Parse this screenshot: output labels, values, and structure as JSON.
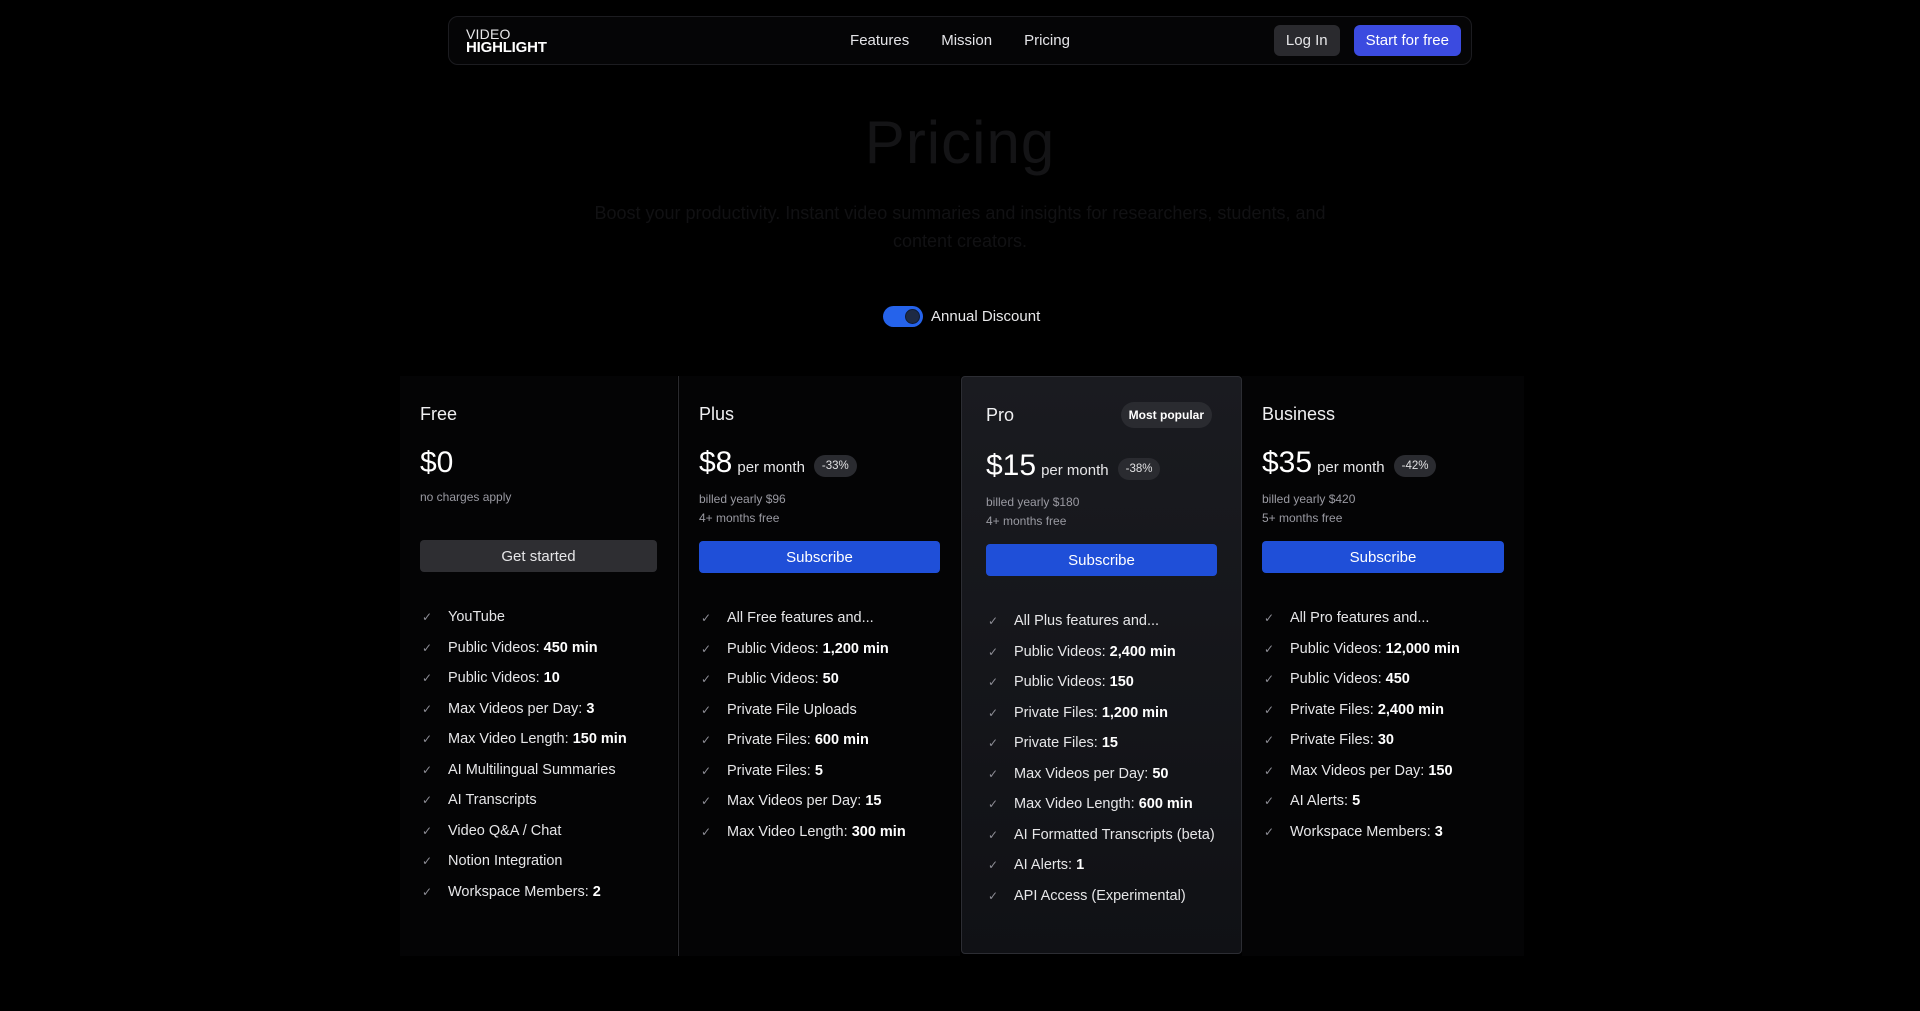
{
  "nav": {
    "logo_top": "VIDEO",
    "logo_bottom": "HIGHLIGHT",
    "links": [
      "Features",
      "Mission",
      "Pricing"
    ],
    "login": "Log In",
    "start": "Start for free"
  },
  "hero": {
    "title": "Pricing",
    "subtitle": "Boost your productivity. Instant video summaries and insights for researchers, students, and content creators."
  },
  "toggle": {
    "label": "Annual Discount",
    "on": true
  },
  "plans": [
    {
      "name": "Free",
      "price": "$0",
      "per": "",
      "discount": "",
      "note1": "no charges apply",
      "note2": "",
      "cta": "Get started",
      "features": [
        {
          "label": "YouTube",
          "value": ""
        },
        {
          "label": "Public Videos: ",
          "value": "450 min"
        },
        {
          "label": "Public Videos: ",
          "value": "10"
        },
        {
          "label": "Max Videos per Day: ",
          "value": "3"
        },
        {
          "label": "Max Video Length: ",
          "value": "150 min"
        },
        {
          "label": "AI Multilingual Summaries",
          "value": ""
        },
        {
          "label": "AI Transcripts",
          "value": ""
        },
        {
          "label": "Video Q&A / Chat",
          "value": ""
        },
        {
          "label": "Notion Integration",
          "value": ""
        },
        {
          "label": "Workspace Members: ",
          "value": "2"
        }
      ]
    },
    {
      "name": "Plus",
      "price": "$8",
      "per": "per month",
      "discount": "-33%",
      "note1": "billed yearly $96",
      "note2": "4+ months free",
      "cta": "Subscribe",
      "features": [
        {
          "label": "All Free features and...",
          "value": ""
        },
        {
          "label": "Public Videos: ",
          "value": "1,200 min"
        },
        {
          "label": "Public Videos: ",
          "value": "50"
        },
        {
          "label": "Private File Uploads",
          "value": ""
        },
        {
          "label": "Private Files: ",
          "value": "600 min"
        },
        {
          "label": "Private Files: ",
          "value": "5"
        },
        {
          "label": "Max Videos per Day: ",
          "value": "15"
        },
        {
          "label": "Max Video Length: ",
          "value": "300 min"
        }
      ]
    },
    {
      "name": "Pro",
      "badge": "Most popular",
      "price": "$15",
      "per": "per month",
      "discount": "-38%",
      "note1": "billed yearly $180",
      "note2": "4+ months free",
      "cta": "Subscribe",
      "features": [
        {
          "label": "All Plus features and...",
          "value": ""
        },
        {
          "label": "Public Videos: ",
          "value": "2,400 min"
        },
        {
          "label": "Public Videos: ",
          "value": "150"
        },
        {
          "label": "Private Files: ",
          "value": "1,200 min"
        },
        {
          "label": "Private Files: ",
          "value": "15"
        },
        {
          "label": "Max Videos per Day: ",
          "value": "50"
        },
        {
          "label": "Max Video Length: ",
          "value": "600 min"
        },
        {
          "label": "AI Formatted Transcripts (beta)",
          "value": ""
        },
        {
          "label": "AI Alerts: ",
          "value": "1"
        },
        {
          "label": "API Access (Experimental)",
          "value": ""
        }
      ]
    },
    {
      "name": "Business",
      "price": "$35",
      "per": "per month",
      "discount": "-42%",
      "note1": "billed yearly $420",
      "note2": "5+ months free",
      "cta": "Subscribe",
      "features": [
        {
          "label": "All Pro features and...",
          "value": ""
        },
        {
          "label": "Public Videos: ",
          "value": "12,000 min"
        },
        {
          "label": "Public Videos: ",
          "value": "450"
        },
        {
          "label": "Private Files: ",
          "value": "2,400 min"
        },
        {
          "label": "Private Files: ",
          "value": "30"
        },
        {
          "label": "Max Videos per Day: ",
          "value": "150"
        },
        {
          "label": "AI Alerts: ",
          "value": "5"
        },
        {
          "label": "Workspace Members: ",
          "value": "3"
        }
      ]
    }
  ],
  "colors": {
    "accent": "#3b4be0",
    "subscribe": "#1f4fd8",
    "toggle": "#2563eb",
    "background": "#000000"
  },
  "icons": {
    "feature_check": "check-icon"
  }
}
